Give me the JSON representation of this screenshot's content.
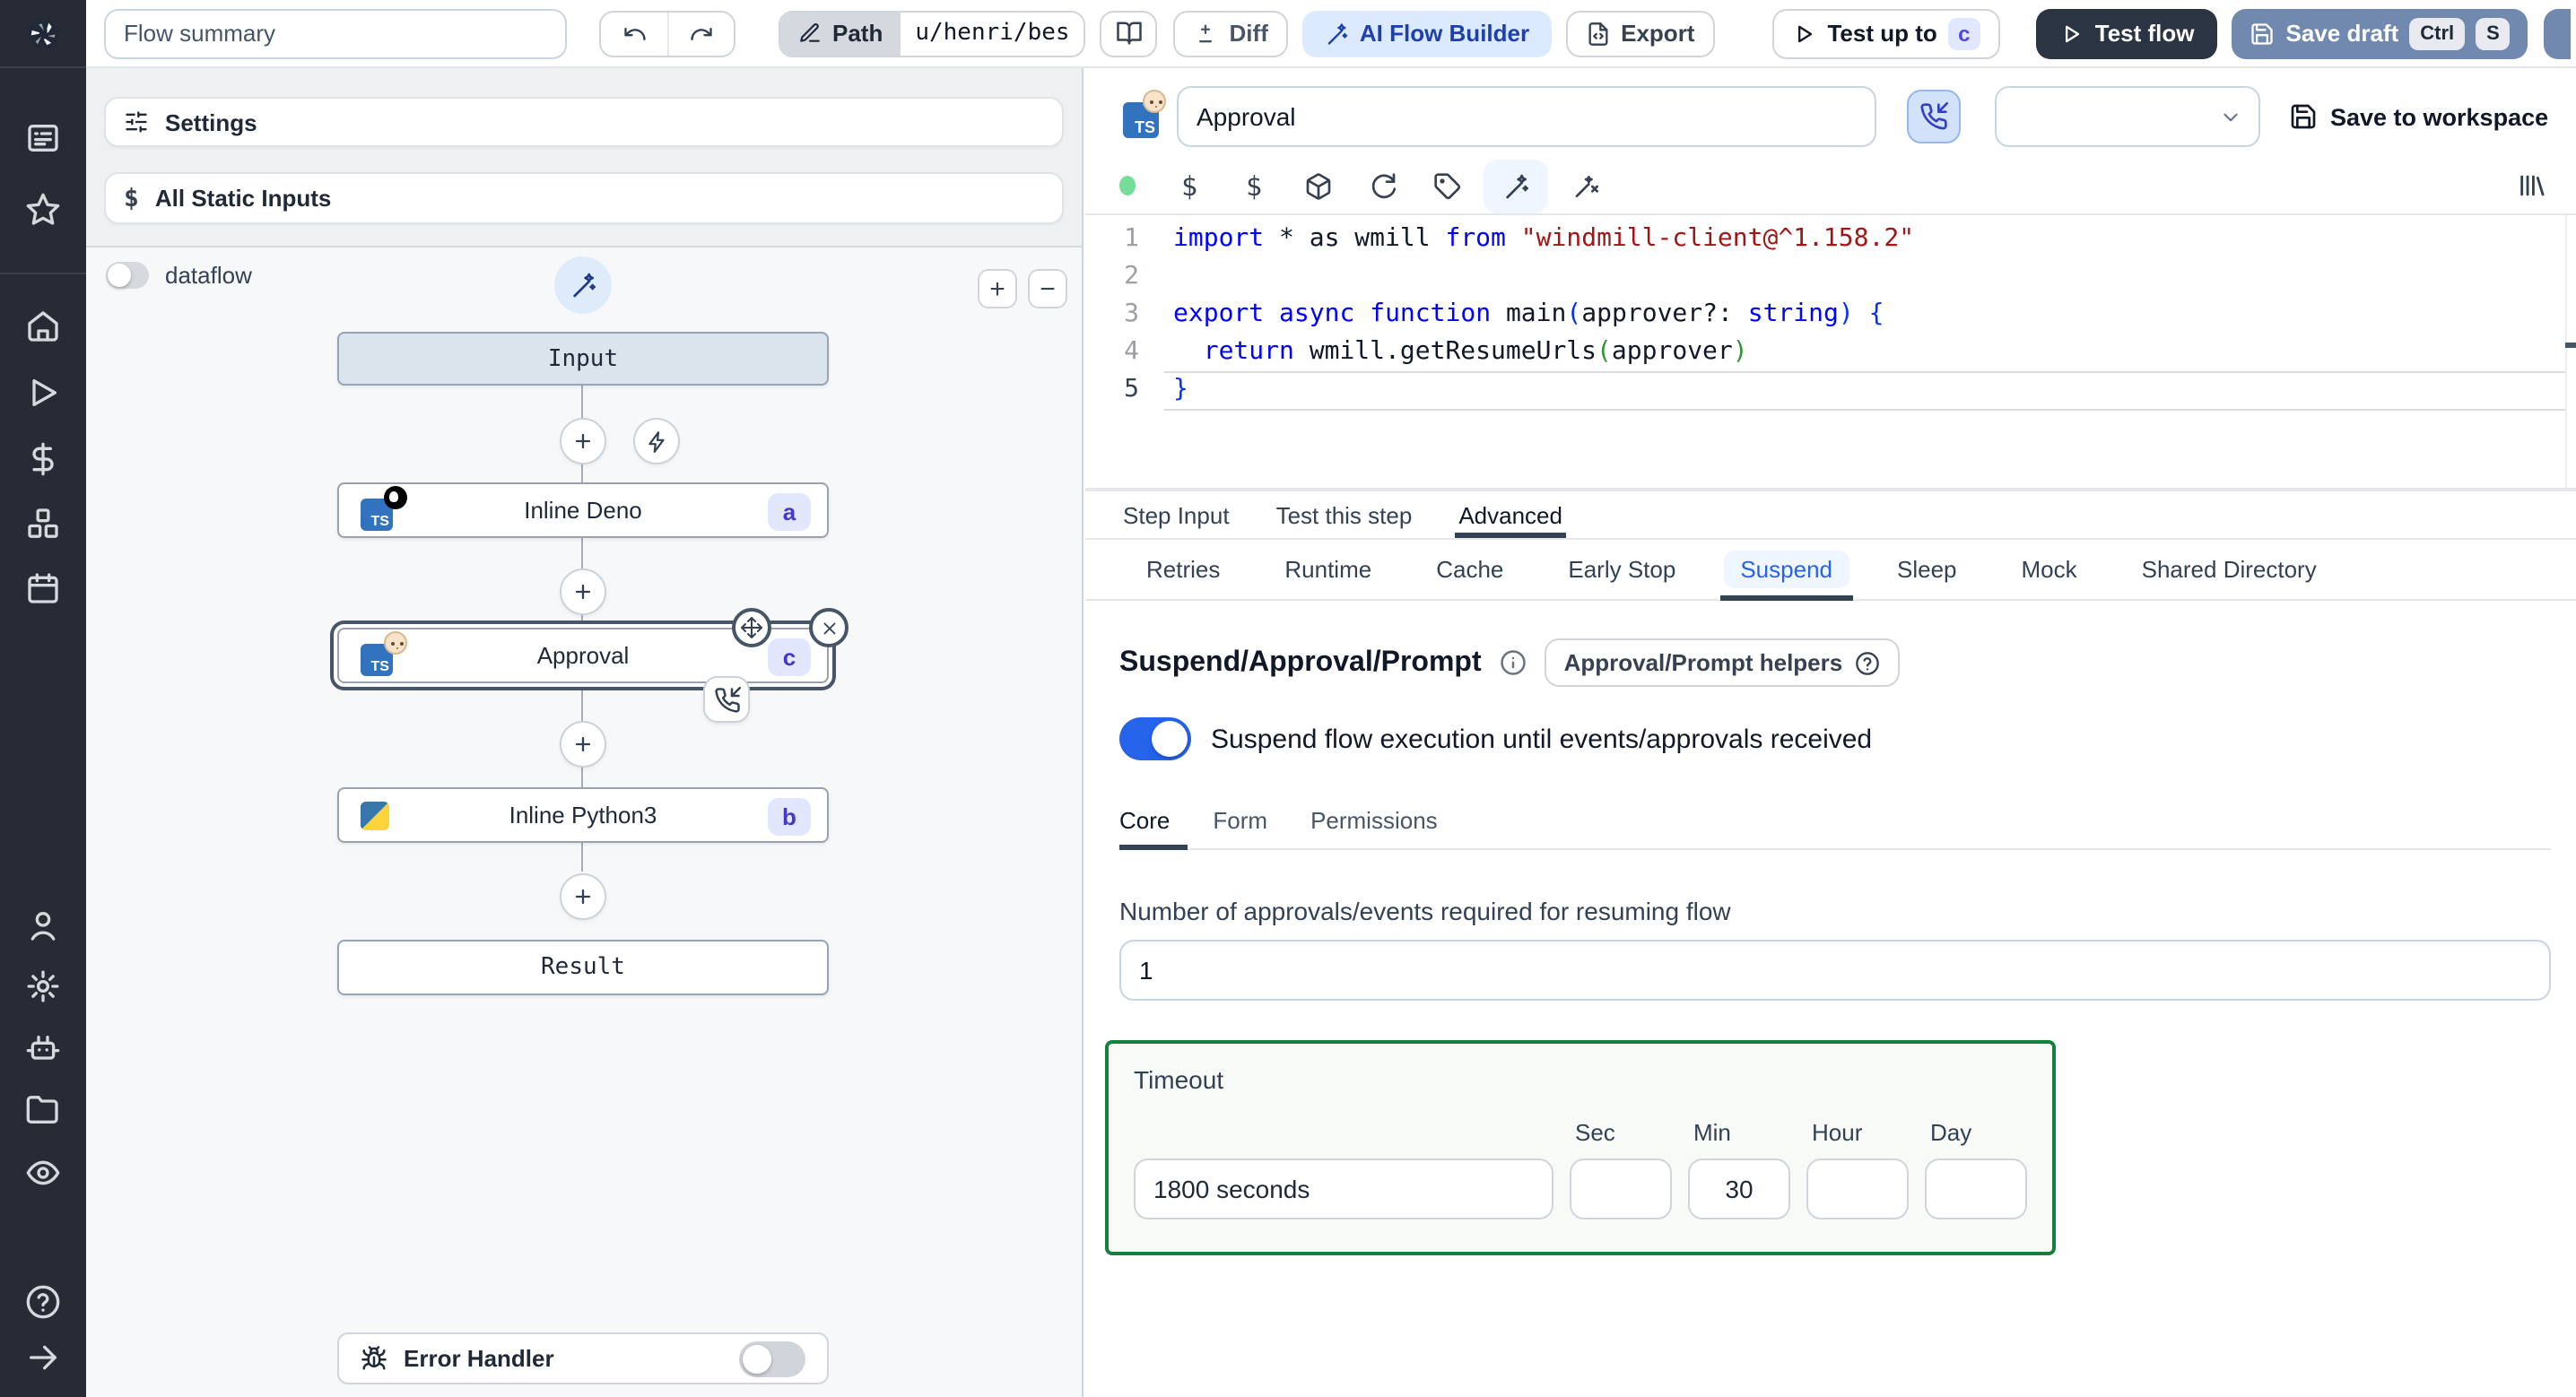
{
  "topbar": {
    "flow_summary_value": "Flow summary",
    "path_label": "Path",
    "path_value": "u/henri/bes",
    "diff_label": "Diff",
    "ai_flow_builder_label": "AI Flow Builder",
    "export_label": "Export",
    "test_up_to_label": "Test up to",
    "test_up_to_badge": "c",
    "test_flow_label": "Test flow",
    "save_draft_label": "Save draft",
    "save_draft_kbd": [
      "Ctrl",
      "S"
    ]
  },
  "sidebar": {
    "logo": "windmill-logo",
    "icons": [
      "apps",
      "favorites-star",
      "home",
      "runs-play",
      "variables-dollar",
      "resources-boxes",
      "schedules-calendar",
      "users-person",
      "workspace-settings-gear",
      "workers-robot",
      "folders",
      "audit-logs-eye",
      "help-question",
      "expand-arrow"
    ]
  },
  "left_panel": {
    "settings_label": "Settings",
    "static_inputs_label": "All Static Inputs",
    "dataflow_label": "dataflow",
    "zoom_in_label": "+",
    "zoom_out_label": "−",
    "error_handler_label": "Error Handler",
    "nodes": {
      "input": {
        "label": "Input"
      },
      "deno": {
        "label": "Inline Deno",
        "badge": "a",
        "lang": "deno-typescript"
      },
      "approval": {
        "label": "Approval",
        "badge": "c",
        "lang": "approval-typescript",
        "selected": true
      },
      "python": {
        "label": "Inline Python3",
        "badge": "b",
        "lang": "python3"
      },
      "result": {
        "label": "Result"
      }
    }
  },
  "step_editor": {
    "name_value": "Approval",
    "save_to_workspace_label": "Save to workspace",
    "editor": {
      "line_numbers": [
        "1",
        "2",
        "3",
        "4",
        "5"
      ],
      "lines": [
        [
          {
            "t": "import",
            "c": "kw"
          },
          {
            "t": " * as wmill ",
            "c": "pl"
          },
          {
            "t": "from",
            "c": "kw"
          },
          {
            "t": " ",
            "c": "pl"
          },
          {
            "t": "\"windmill-client@^1.158.2\"",
            "c": "str"
          }
        ],
        [],
        [
          {
            "t": "export",
            "c": "kw"
          },
          {
            "t": " ",
            "c": "pl"
          },
          {
            "t": "async",
            "c": "kw"
          },
          {
            "t": " ",
            "c": "pl"
          },
          {
            "t": "function",
            "c": "kw"
          },
          {
            "t": " main",
            "c": "pl"
          },
          {
            "t": "(",
            "c": "b1"
          },
          {
            "t": "approver?: ",
            "c": "pl"
          },
          {
            "t": "string",
            "c": "kw"
          },
          {
            "t": ")",
            "c": "b1"
          },
          {
            "t": " {",
            "c": "b1"
          }
        ],
        [
          {
            "t": "  ",
            "c": "pl"
          },
          {
            "t": "return",
            "c": "kw"
          },
          {
            "t": " wmill.getResumeUrls",
            "c": "pl"
          },
          {
            "t": "(",
            "c": "b2"
          },
          {
            "t": "approver",
            "c": "pl"
          },
          {
            "t": ")",
            "c": "b2"
          }
        ],
        [
          {
            "t": "}",
            "c": "b1"
          }
        ]
      ]
    },
    "tabs": [
      "Step Input",
      "Test this step",
      "Advanced"
    ],
    "active_tab": "Advanced",
    "subtabs": [
      "Retries",
      "Runtime",
      "Cache",
      "Early Stop",
      "Suspend",
      "Sleep",
      "Mock",
      "Shared Directory"
    ],
    "active_subtab": "Suspend",
    "suspend": {
      "heading": "Suspend/Approval/Prompt",
      "helpers_label": "Approval/Prompt helpers",
      "toggle_label": "Suspend flow execution until events/approvals received",
      "toggle_on": true,
      "tabs": [
        "Core",
        "Form",
        "Permissions"
      ],
      "active_tab": "Core",
      "approvals_label": "Number of approvals/events required for resuming flow",
      "approvals_value": "1",
      "timeout_label": "Timeout",
      "timeout_value": "1800 seconds",
      "unit_labels": [
        "Sec",
        "Min",
        "Hour",
        "Day"
      ],
      "unit_values": [
        "",
        "30",
        "",
        ""
      ]
    }
  },
  "colors": {
    "accent_blue": "#2563eb",
    "ai_builder_bg": "#dbeafe",
    "step_badge_bg": "#e0e7ff",
    "step_badge_text": "#4338ca",
    "test_flow_bg": "#2b3442",
    "save_draft_bg": "#7189ae",
    "timeout_border_green": "#15803d",
    "sidebar_bg": "#272b35",
    "assistant_ok_green": "#74dd98"
  }
}
